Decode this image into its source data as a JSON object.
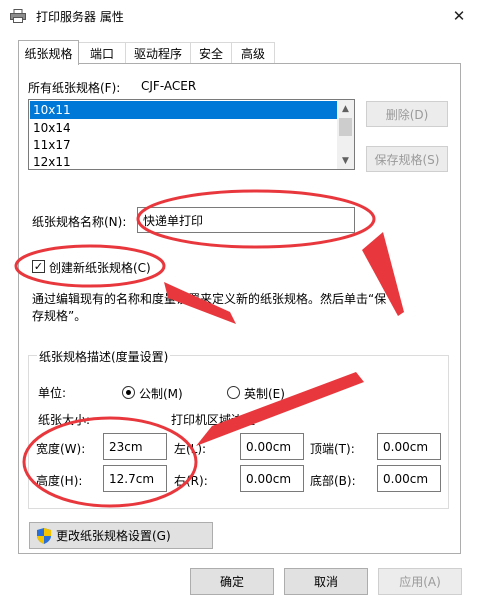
{
  "window": {
    "title": "打印服务器 属性",
    "close_glyph": "✕"
  },
  "tabs": [
    {
      "label": "纸张规格",
      "active": true
    },
    {
      "label": "端口"
    },
    {
      "label": "驱动程序"
    },
    {
      "label": "安全"
    },
    {
      "label": "高级"
    }
  ],
  "forms": {
    "all_label": "所有纸张规格(F):",
    "server_name": "CJF-ACER",
    "list_items": [
      "10x11",
      "10x14",
      "11x17",
      "12x11"
    ],
    "selected_index": 0,
    "delete_button": "删除(D)",
    "save_button": "保存规格(S)",
    "name_label": "纸张规格名称(N):",
    "name_value": "快递单打印",
    "create_checkbox_label": "创建新纸张规格(C)",
    "create_checked": true,
    "description": "通过编辑现有的名称和度量设置来定义新的纸张规格。然后单击“保存规格”。"
  },
  "measurements": {
    "group_title": "纸张规格描述(度量设置)",
    "unit_label": "单位:",
    "metric_label": "公制(M)",
    "english_label": "英制(E)",
    "metric_selected": true,
    "paper_size_label": "纸张大小:",
    "margins_label": "打印机区域边距",
    "width_label": "宽度(W):",
    "width_value": "23cm",
    "height_label": "高度(H):",
    "height_value": "12.7cm",
    "left_label": "左(L):",
    "left_value": "0.00cm",
    "right_label": "右(R):",
    "right_value": "0.00cm",
    "top_label": "顶端(T):",
    "top_value": "0.00cm",
    "bottom_label": "底部(B):",
    "bottom_value": "0.00cm"
  },
  "change_settings_button": "更改纸张规格设置(G)",
  "footer": {
    "ok": "确定",
    "cancel": "取消",
    "apply": "应用(A)"
  },
  "colors": {
    "selection": "#0078d7",
    "annotation": "#e8383d"
  }
}
